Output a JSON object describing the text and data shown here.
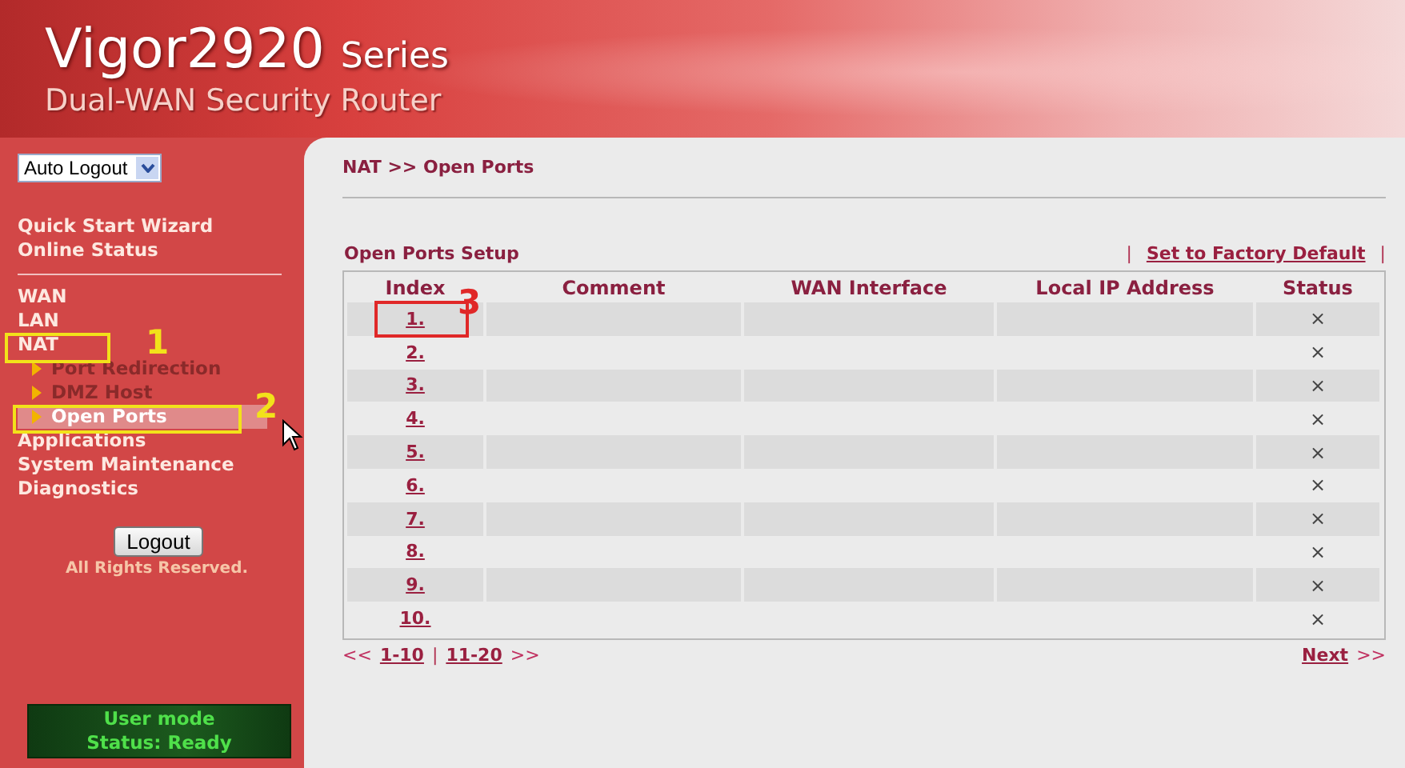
{
  "header": {
    "title": "Vigor2920",
    "series": "Series",
    "subtitle": "Dual-WAN Security Router"
  },
  "sidebar": {
    "auto_logout": {
      "value": "Auto Logout"
    },
    "sections": [
      [
        {
          "label": "Quick Start Wizard"
        },
        {
          "label": "Online Status"
        }
      ],
      [
        {
          "label": "WAN"
        },
        {
          "label": "LAN"
        },
        {
          "label": "NAT",
          "children": [
            {
              "label": "Port Redirection",
              "selected": false
            },
            {
              "label": "DMZ Host",
              "selected": false
            },
            {
              "label": "Open Ports",
              "selected": true
            }
          ]
        },
        {
          "label": "Applications"
        },
        {
          "label": "System Maintenance"
        },
        {
          "label": "Diagnostics"
        }
      ]
    ],
    "logout_button": "Logout",
    "copyright": "All Rights Reserved.",
    "status_box": [
      "User mode",
      "Status: Ready"
    ]
  },
  "breadcrumb": "NAT >> Open Ports",
  "section_title": "Open Ports Setup",
  "factory_default": {
    "left_sep": "|",
    "link": "Set to Factory Default",
    "right_sep": "|"
  },
  "table": {
    "columns": [
      "Index",
      "Comment",
      "WAN Interface",
      "Local IP Address",
      "Status"
    ],
    "rows": [
      {
        "index": "1.",
        "status": "×"
      },
      {
        "index": "2.",
        "status": "×"
      },
      {
        "index": "3.",
        "status": "×"
      },
      {
        "index": "4.",
        "status": "×"
      },
      {
        "index": "5.",
        "status": "×"
      },
      {
        "index": "6.",
        "status": "×"
      },
      {
        "index": "7.",
        "status": "×"
      },
      {
        "index": "8.",
        "status": "×"
      },
      {
        "index": "9.",
        "status": "×"
      },
      {
        "index": "10.",
        "status": "×"
      }
    ]
  },
  "pagination": {
    "prev": "<<",
    "pages": [
      "1-10",
      "11-20"
    ],
    "separator": "|",
    "more": ">>",
    "next": "Next",
    "next_arrow": ">>"
  },
  "annotations": [
    {
      "label": "1",
      "color": "#f2e21a"
    },
    {
      "label": "2",
      "color": "#f2e21a"
    },
    {
      "label": "3",
      "color": "#e02828"
    }
  ]
}
